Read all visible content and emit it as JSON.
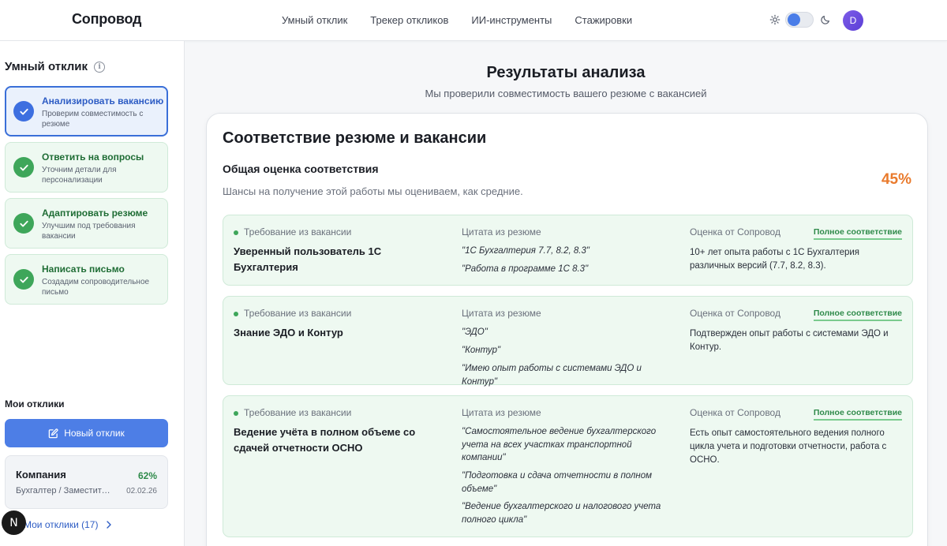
{
  "header": {
    "logo": "Сопровод",
    "nav": [
      "Умный отклик",
      "Трекер откликов",
      "ИИ-инструменты",
      "Стажировки"
    ],
    "avatar_letter": "D"
  },
  "sidebar": {
    "title": "Умный отклик",
    "steps": [
      {
        "title": "Анализировать вакансию",
        "subtitle": "Проверим совместимость с резюме",
        "state": "active"
      },
      {
        "title": "Ответить на вопросы",
        "subtitle": "Уточним детали для персонализации",
        "state": "done"
      },
      {
        "title": "Адаптировать резюме",
        "subtitle": "Улучшим под требования вакансии",
        "state": "done"
      },
      {
        "title": "Написать письмо",
        "subtitle": "Создадим сопроводительное письмо",
        "state": "done"
      }
    ],
    "my_title": "Мои отклики",
    "new_button": "Новый отклик",
    "company": {
      "name": "Компания",
      "percent": "62%",
      "role": "Бухгалтер / Заместитель главного бухгалтера",
      "date": "02.02.26"
    },
    "all_link": "Мои отклики (17)",
    "badge_letter": "N"
  },
  "main": {
    "title": "Результаты анализа",
    "subtitle": "Мы проверили совместимость вашего резюме с вакансией",
    "card_title": "Соответствие резюме и вакансии",
    "score_label": "Общая оценка соответствия",
    "score_desc": "Шансы на получение этой работы мы оцениваем, как средние.",
    "score_percent": "45%",
    "col_requirement": "Требование из вакансии",
    "col_quote": "Цитата из резюме",
    "col_eval": "Оценка от Сопровод",
    "requirements": [
      {
        "name": "Уверенный пользователь 1С Бухгалтерия",
        "quotes": [
          "\"1С Бухгалтерия 7.7, 8.2, 8.3\"",
          "\"Работа в программе 1С 8.3\""
        ],
        "badge": "Полное соответствие",
        "evaluation": "10+ лет опыта работы с 1С Бухгалтерия различных версий (7.7, 8.2, 8.3)."
      },
      {
        "name": "Знание ЭДО и Контур",
        "quotes": [
          "\"ЭДО\"",
          "\"Контур\"",
          "\"Имею опыт работы с системами ЭДО и Контур\""
        ],
        "badge": "Полное соответствие",
        "evaluation": "Подтвержден опыт работы с системами ЭДО и Контур."
      },
      {
        "name": "Ведение учёта в полном объеме со сдачей отчетности ОСНО",
        "quotes": [
          "\"Самостоятельное ведение бухгалтерского учета на всех участках транспортной компании\"",
          "\"Подготовка и сдача отчетности в полном объеме\"",
          "\"Ведение бухгалтерского и налогового учета полного цикла\""
        ],
        "badge": "Полное соответствие",
        "evaluation": "Есть опыт самостоятельного ведения полного цикла учета и подготовки отчетности, работа с ОСНО."
      }
    ]
  }
}
